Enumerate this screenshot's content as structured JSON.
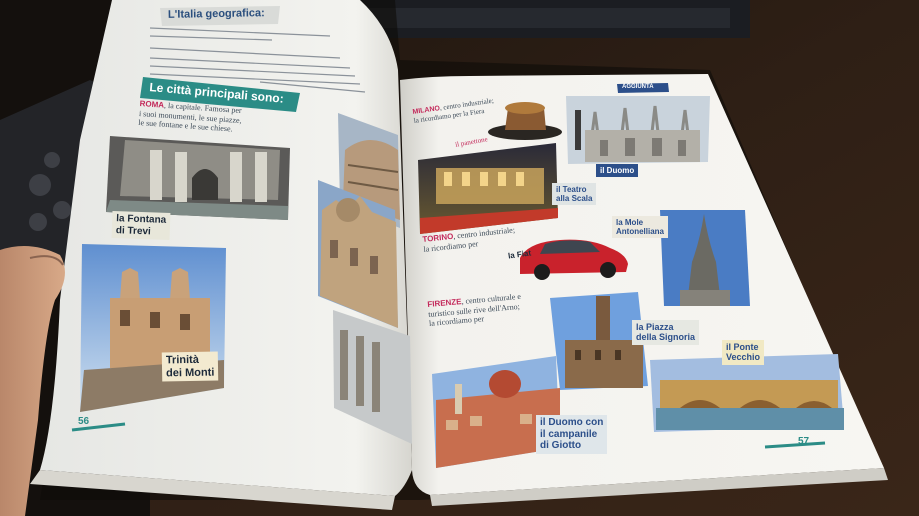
{
  "left_page": {
    "section_title": "L'Italia geografica:",
    "intro_lines": [
      "L'Italia è una penisola con due grandi isole,",
      "i mari dell'Italia sono:",
      "Le catene montuose ...",
      "I fiumi principali sono: ...",
      "I laghi d'Italia sono: ..."
    ],
    "cities_heading": "Le città principali sono:",
    "rome_city": "ROMA",
    "rome_text": [
      ", la capitale. Famosa per",
      "i suoi monumenti, le sue piazze,",
      "le sue fontane e le sue chiese."
    ],
    "captions": {
      "fontana_line1": "la Fontana",
      "fontana_line2": "di Trevi",
      "trinita_line1": "Trinità",
      "trinita_line2": "dei Monti"
    },
    "page_number": "56"
  },
  "right_page": {
    "tab_label": "AGGIUNTA",
    "milano_city": "MILANO",
    "milano_text": [
      ", centro industriale;",
      "la ricordiamo per la Fiera"
    ],
    "panettone_label": "il panettone",
    "captions": {
      "duomo": "il Duomo",
      "teatro_line1": "il Teatro",
      "teatro_line2": "alla Scala",
      "mole_line1": "la Mole",
      "mole_line2": "Antonelliana",
      "fiat": "la Fiat",
      "piazza_line1": "la Piazza",
      "piazza_line2": "della Signoria",
      "ponte_line1": "il Ponte",
      "ponte_line2": "Vecchio",
      "duomo_firenze_line1": "il Duomo con",
      "duomo_firenze_line2": "il campanile",
      "duomo_firenze_line3": "di Giotto"
    },
    "torino_city": "TORINO",
    "torino_text": [
      ", centro industriale;",
      "la ricordiamo per"
    ],
    "firenze_city": "FIRENZE",
    "firenze_text": [
      ", centro culturale e",
      "turistico sulle rive dell'Arno;",
      "la ricordiamo per"
    ],
    "page_number": "57"
  },
  "colors": {
    "desk": "#2a1c14",
    "page": "#f4f3ee",
    "heading_teal": "#2b8c86",
    "caption_blue": "#2c4f8a",
    "accent_red": "#c3295a"
  }
}
